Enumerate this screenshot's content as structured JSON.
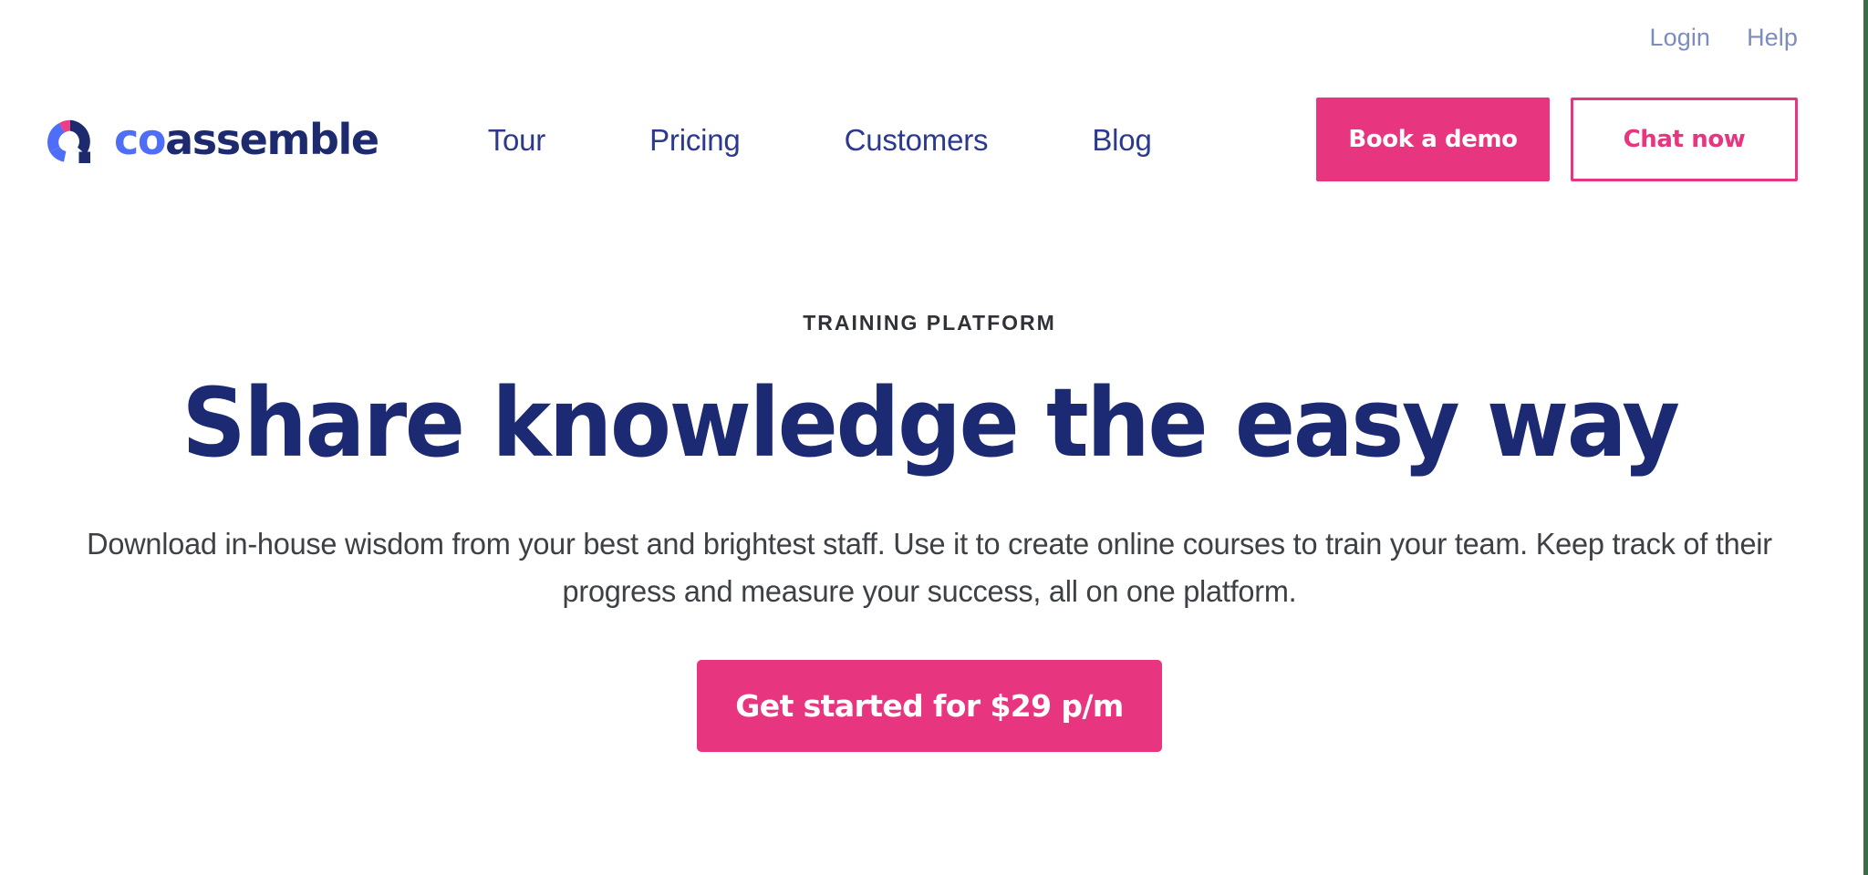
{
  "brand": {
    "mark_icon": "coassemble-ring-logo-icon",
    "wordmark_primary": "co",
    "wordmark_secondary": "assemble",
    "colors": {
      "ring_blue": "#4f6ef7",
      "ring_pink": "#ec3d86",
      "ring_navy": "#1d2a6e",
      "dot_navy": "#1d2a6e"
    }
  },
  "utility_nav": {
    "items": [
      {
        "label": "Login"
      },
      {
        "label": "Help"
      }
    ]
  },
  "primary_nav": {
    "items": [
      {
        "label": "Tour"
      },
      {
        "label": "Pricing"
      },
      {
        "label": "Customers"
      },
      {
        "label": "Blog"
      }
    ]
  },
  "header_actions": {
    "book_demo_label": "Book a demo",
    "chat_now_label": "Chat now"
  },
  "hero": {
    "eyebrow": "TRAINING PLATFORM",
    "title": "Share knowledge the easy way",
    "subtitle": "Download in-house wisdom from your best and brightest staff. Use it to create online courses to train your team. Keep track of their progress and measure your success, all on one platform.",
    "cta_label": "Get started for $29 p/m"
  },
  "theme": {
    "accent_pink": "#e8357f",
    "navy": "#1c2a73",
    "nav_blue": "#2b3a8f",
    "utility_blue": "#7e8bbd",
    "body_grey": "#3d4145",
    "page_border_green": "#3d6b46",
    "background": "#ffffff"
  }
}
